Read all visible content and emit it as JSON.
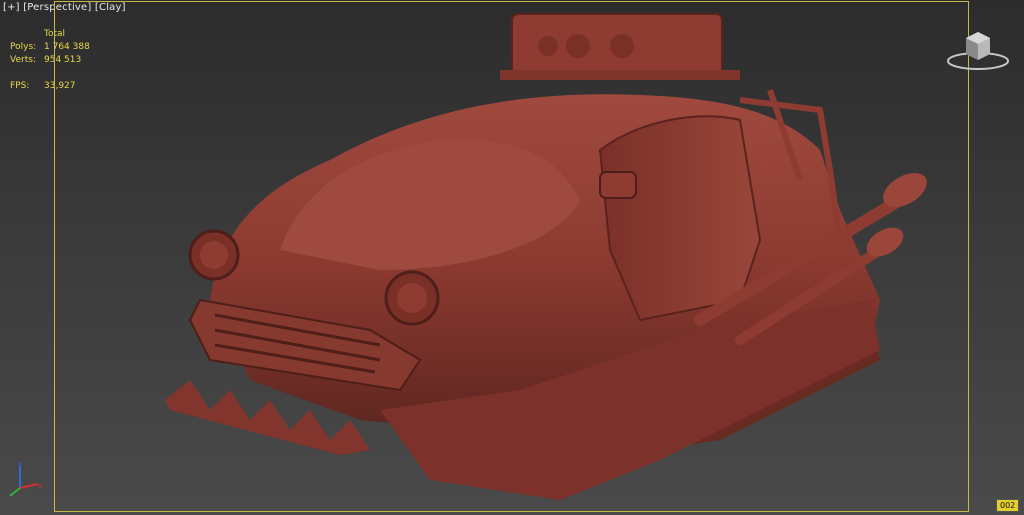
{
  "viewport": {
    "labels": {
      "plus": "[+]",
      "view": "[Perspective]",
      "shading": "[Clay]"
    },
    "stats": {
      "header": "Total",
      "polys_label": "Polys:",
      "polys_value": "1 764 388",
      "verts_label": "Verts:",
      "verts_value": "954 513",
      "fps_label": "FPS:",
      "fps_value": "33,927"
    },
    "frame_badge": "002"
  },
  "colors": {
    "safe_frame": "#c8b94a",
    "stats_text": "#e7d84a",
    "clay": "#8c3a30"
  },
  "icons": [
    "viewcube-icon",
    "axis-gizmo-icon"
  ]
}
